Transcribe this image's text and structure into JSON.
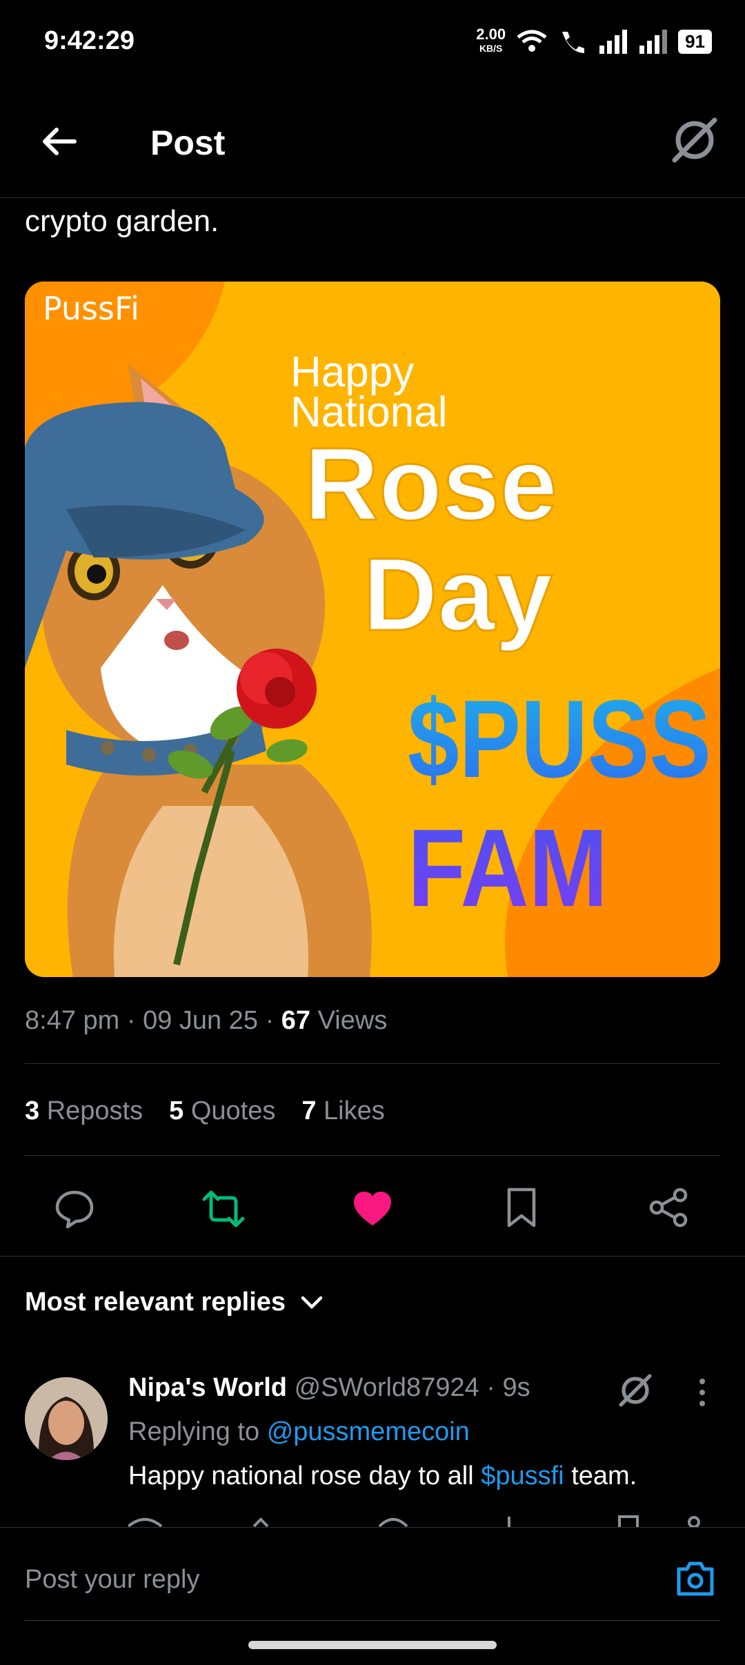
{
  "status_bar": {
    "time": "9:42:29",
    "speed_value": "2.00",
    "speed_unit": "KB/S",
    "battery": "91"
  },
  "header": {
    "title": "Post"
  },
  "post": {
    "text_tail": "crypto garden.",
    "image": {
      "brand": "PussFi",
      "line1": "Happy",
      "line2": "National",
      "line3": "Rose",
      "line4": "Day",
      "line5": "$PUSS",
      "line6": "FAM"
    },
    "meta": {
      "time": "8:47 pm",
      "date": "09 Jun 25",
      "views_count": "67",
      "views_label": "Views"
    },
    "stats": [
      {
        "count": "3",
        "label": "Reposts"
      },
      {
        "count": "5",
        "label": "Quotes"
      },
      {
        "count": "7",
        "label": "Likes"
      }
    ]
  },
  "colors": {
    "accent": "#1d9bf0",
    "repost": "#00ba7c",
    "like": "#f91880"
  },
  "replies": {
    "section_title": "Most relevant replies",
    "items": [
      {
        "name": "Nipa's World",
        "handle": "@SWorld87924",
        "time": "9s",
        "replying_label": "Replying to",
        "replying_handle": "@pussmemecoin",
        "text_before": "Happy national rose day to all",
        "cashtag": "$pussfi",
        "text_after": "team."
      }
    ]
  },
  "composer": {
    "placeholder": "Post your reply"
  }
}
